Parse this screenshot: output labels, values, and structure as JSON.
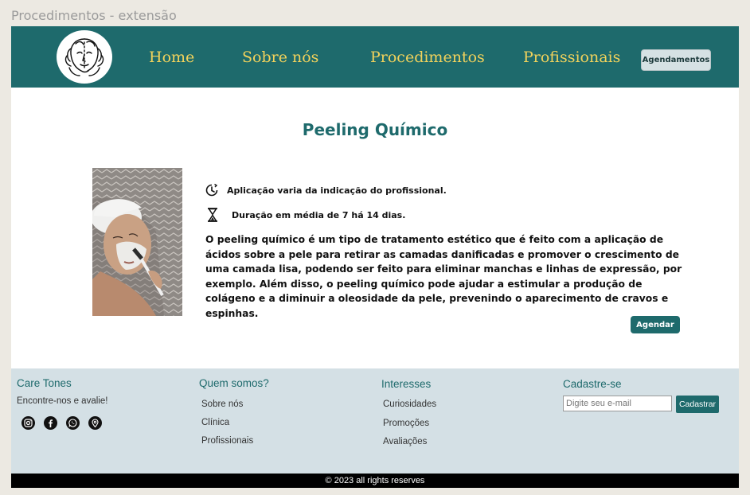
{
  "window": {
    "title": "Procedimentos - extensão"
  },
  "header": {
    "logo_icon": "face-line-art-logo",
    "nav": {
      "home": "Home",
      "about": "Sobre nós",
      "procedures": "Procedimentos",
      "professionals": "Profissionais"
    },
    "appointments_button": "Agendamentos"
  },
  "main": {
    "title": "Peeling Químico",
    "application_icon": "clock-icon",
    "application_text": "Aplicação varia da indicação do profissional.",
    "duration_icon": "hourglass-icon",
    "duration_text": "Duração em média de 7 há 14 dias.",
    "description": "O peeling químico é um tipo de tratamento estético que é feito com a aplicação de ácidos sobre a pele para retirar as camadas danificadas e promover o crescimento de uma camada lisa, podendo ser feito para eliminar manchas e linhas de expressão, por exemplo. Além disso, o peeling químico pode ajudar a estimular a produção de colágeno e a diminuir a oleosidade da pele, prevenindo o aparecimento de cravos e espinhas.",
    "schedule_button": "Agendar"
  },
  "footer": {
    "brand": {
      "title": "Care Tones",
      "subtitle": "Encontre-nos e avalie!",
      "social_icons": [
        "instagram-icon",
        "facebook-icon",
        "whatsapp-icon",
        "location-pin-icon"
      ]
    },
    "about": {
      "title": "Quem somos?",
      "links": [
        "Sobre nós",
        "Clínica",
        "Profissionais"
      ]
    },
    "interests": {
      "title": "Interesses",
      "links": [
        "Curiosidades",
        "Promoções",
        "Avaliações"
      ]
    },
    "signup": {
      "title": "Cadastre-se",
      "email_placeholder": "Digite seu e-mail",
      "button": "Cadastrar"
    },
    "copyright": "© 2023 all rights reserves"
  },
  "colors": {
    "primary": "#1e6a6c",
    "nav_text": "#f2d25b",
    "footer_bg": "#d4e0e5",
    "background": "#ece9e2"
  }
}
